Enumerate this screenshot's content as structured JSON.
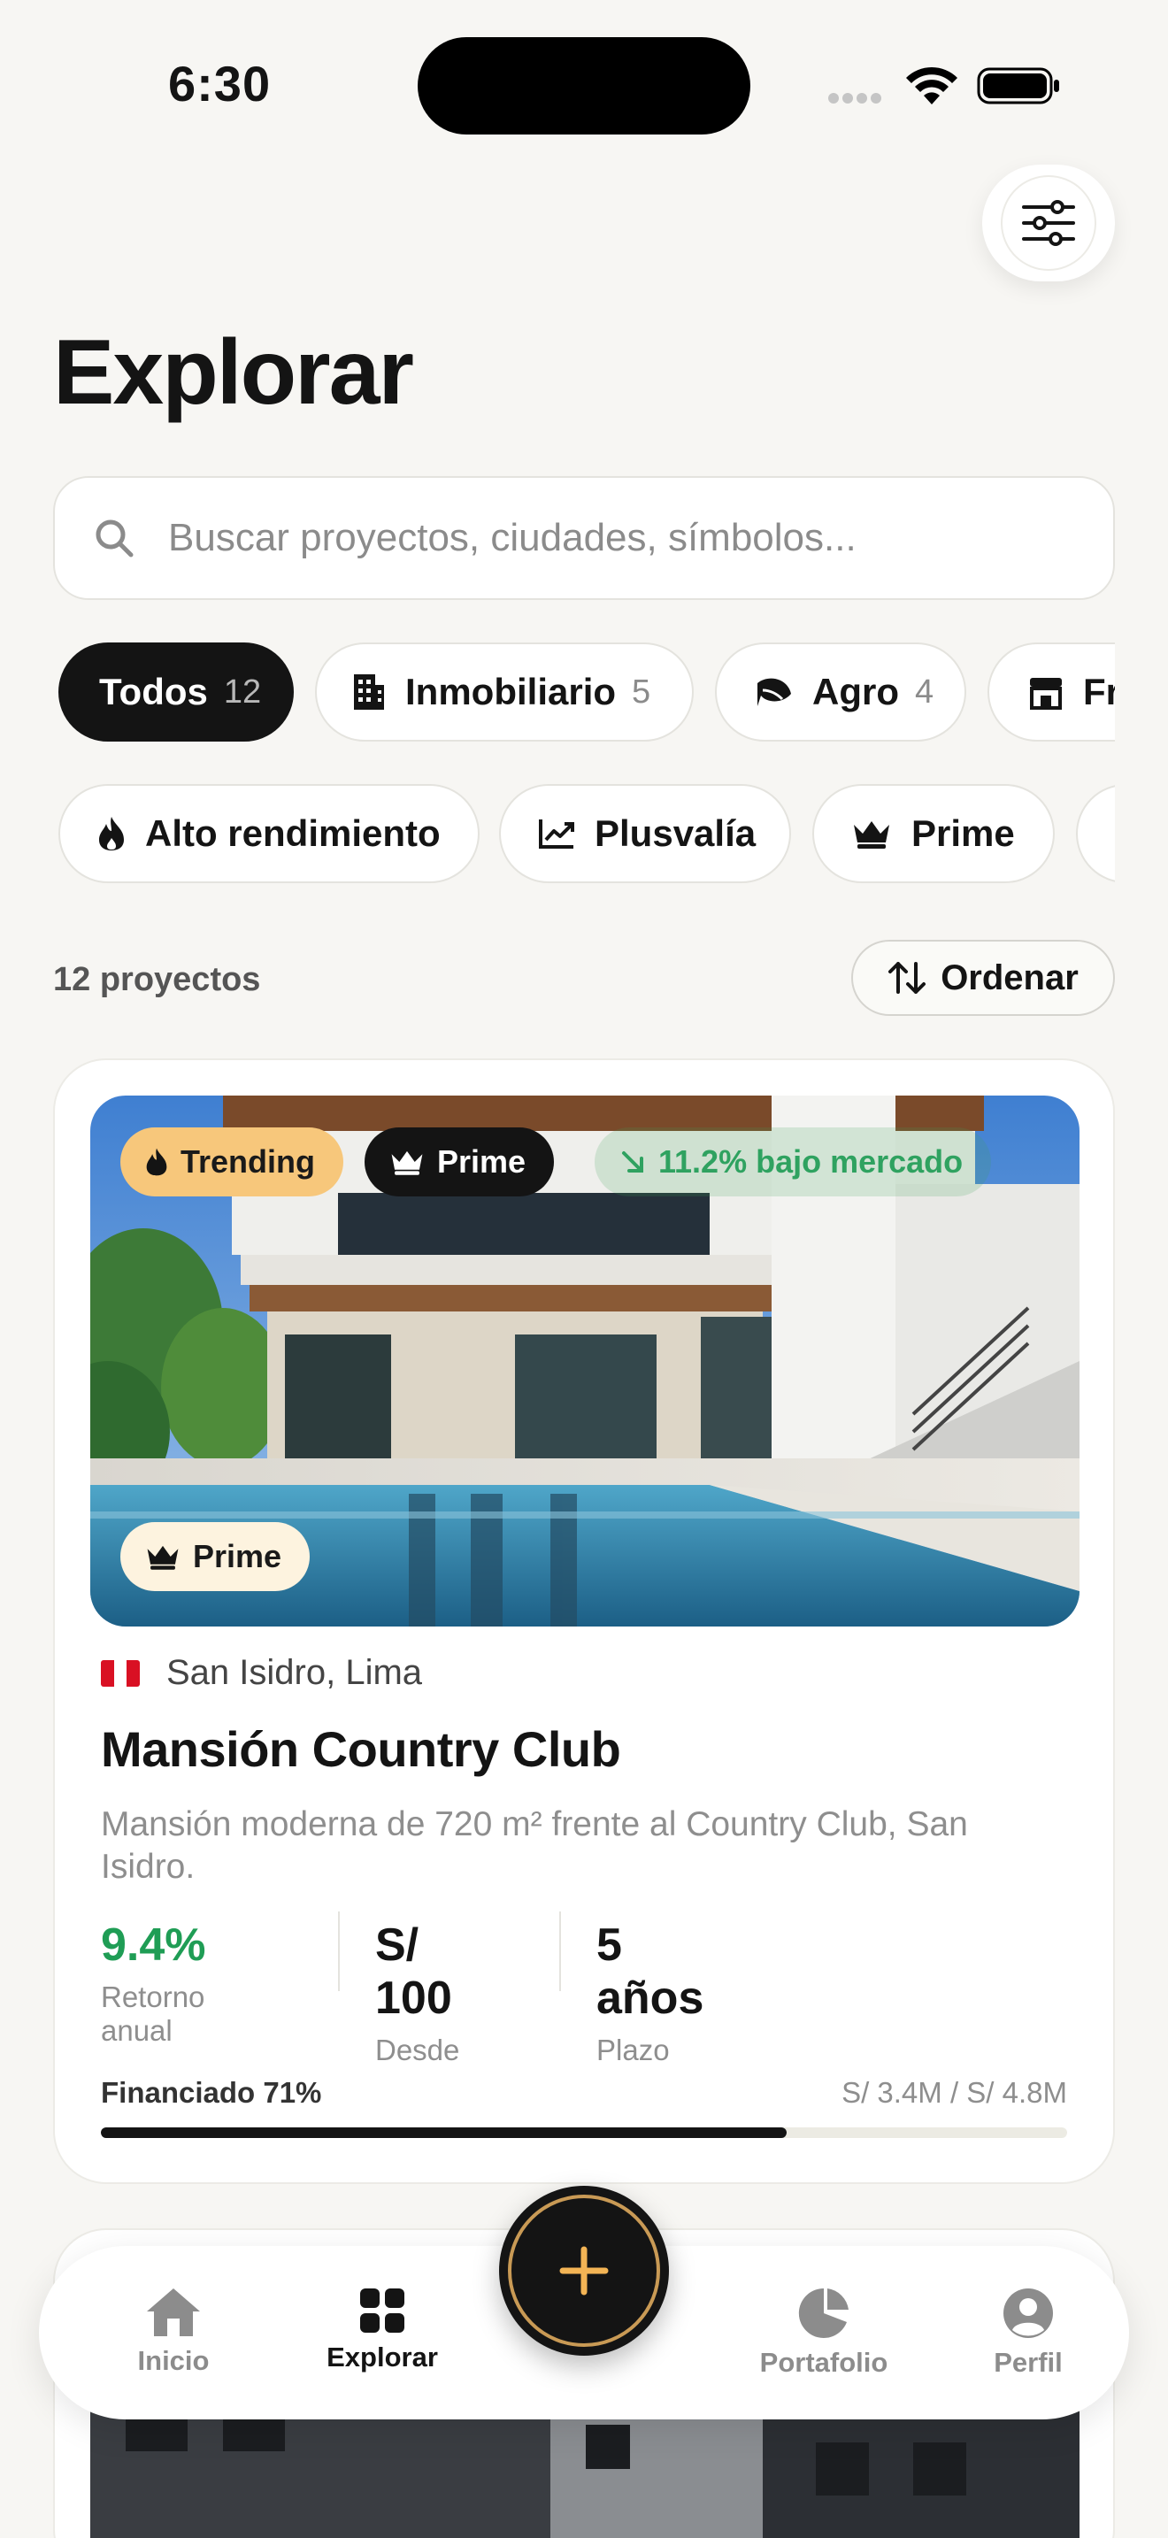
{
  "status_bar": {
    "time": "6:30"
  },
  "header": {
    "title": "Explorar",
    "filter_icon": "sliders-icon"
  },
  "search": {
    "placeholder": "Buscar proyectos, ciudades, símbolos..."
  },
  "categories": [
    {
      "label": "Todos",
      "count": "12",
      "active": true,
      "icon": ""
    },
    {
      "label": "Inmobiliario",
      "count": "5",
      "icon": "building-icon"
    },
    {
      "label": "Agro",
      "count": "4",
      "icon": "leaf-icon"
    },
    {
      "label": "Fr",
      "count": "",
      "icon": "store-icon"
    }
  ],
  "tags": [
    {
      "label": "Alto rendimiento",
      "icon": "flame-icon"
    },
    {
      "label": "Plusvalía",
      "icon": "chart-line-icon"
    },
    {
      "label": "Prime",
      "icon": "crown-icon"
    }
  ],
  "results": {
    "count_label": "12 proyectos",
    "sort_label": "Ordenar"
  },
  "card": {
    "badges": {
      "trending": "Trending",
      "prime": "Prime",
      "market": "11.2% bajo mercado",
      "prime_bottom": "Prime"
    },
    "location": "San Isidro, Lima",
    "title": "Mansión Country Club",
    "description": "Mansión moderna de 720 m² frente al Country Club, San Isidro.",
    "stats": [
      {
        "value": "9.4%",
        "label": "Retorno anual"
      },
      {
        "value": "S/ 100",
        "label": "Desde"
      },
      {
        "value": "5 años",
        "label": "Plazo"
      }
    ],
    "funded_label": "Financiado 71%",
    "funded_amount": "S/ 3.4M / S/ 4.8M",
    "funded_fraction": 0.71
  },
  "nav": {
    "items": [
      {
        "label": "Inicio",
        "icon": "home-icon"
      },
      {
        "label": "Explorar",
        "icon": "grid-icon",
        "active": true
      },
      {
        "label": "Portafolio",
        "icon": "pie-chart-icon"
      },
      {
        "label": "Perfil",
        "icon": "user-icon"
      }
    ],
    "fab_icon": "plus-icon"
  },
  "colors": {
    "accent_gold": "#c99a55",
    "positive_green": "#1f9d55",
    "trending_bg": "#f7c77b"
  }
}
